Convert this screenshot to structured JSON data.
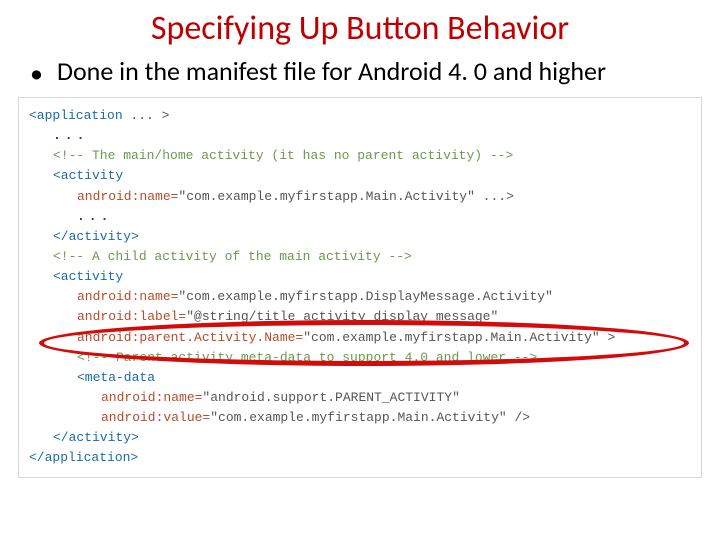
{
  "slide": {
    "title": "Specifying Up Button Behavior",
    "bullet1": "Done in the manifest file for Android 4. 0 and higher"
  },
  "code": {
    "l1_a": "<application",
    "l1_b": " ... >",
    "l2": "...",
    "l3": "<!-- The main/home activity (it has no parent activity) -->",
    "l4": "<activity",
    "l5_a": "android:name=",
    "l5_b": "\"com.example.myfirstapp.Main.Activity\"",
    "l5_c": " ...>",
    "l6": "...",
    "l7": "</activity>",
    "l8": "<!-- A child activity of the main activity -->",
    "l9": "<activity",
    "l10_a": "android:name=",
    "l10_b": "\"com.example.myfirstapp.DisplayMessage.Activity\"",
    "l11_a": "android:label=",
    "l11_b": "\"@string/title_activity_display_message\"",
    "l12_a": "android:parent.Activity.Name=",
    "l12_b": "\"com.example.myfirstapp.Main.Activity\"",
    "l12_c": " >",
    "l13": "<!-- Parent activity meta-data to support 4.0 and lower -->",
    "l14": "<meta-data",
    "l15_a": "android:name=",
    "l15_b": "\"android.support.PARENT_ACTIVITY\"",
    "l16_a": "android:value=",
    "l16_b": "\"com.example.myfirstapp.Main.Activity\"",
    "l16_c": " />",
    "l17": "</activity>",
    "l18": "</application>"
  }
}
